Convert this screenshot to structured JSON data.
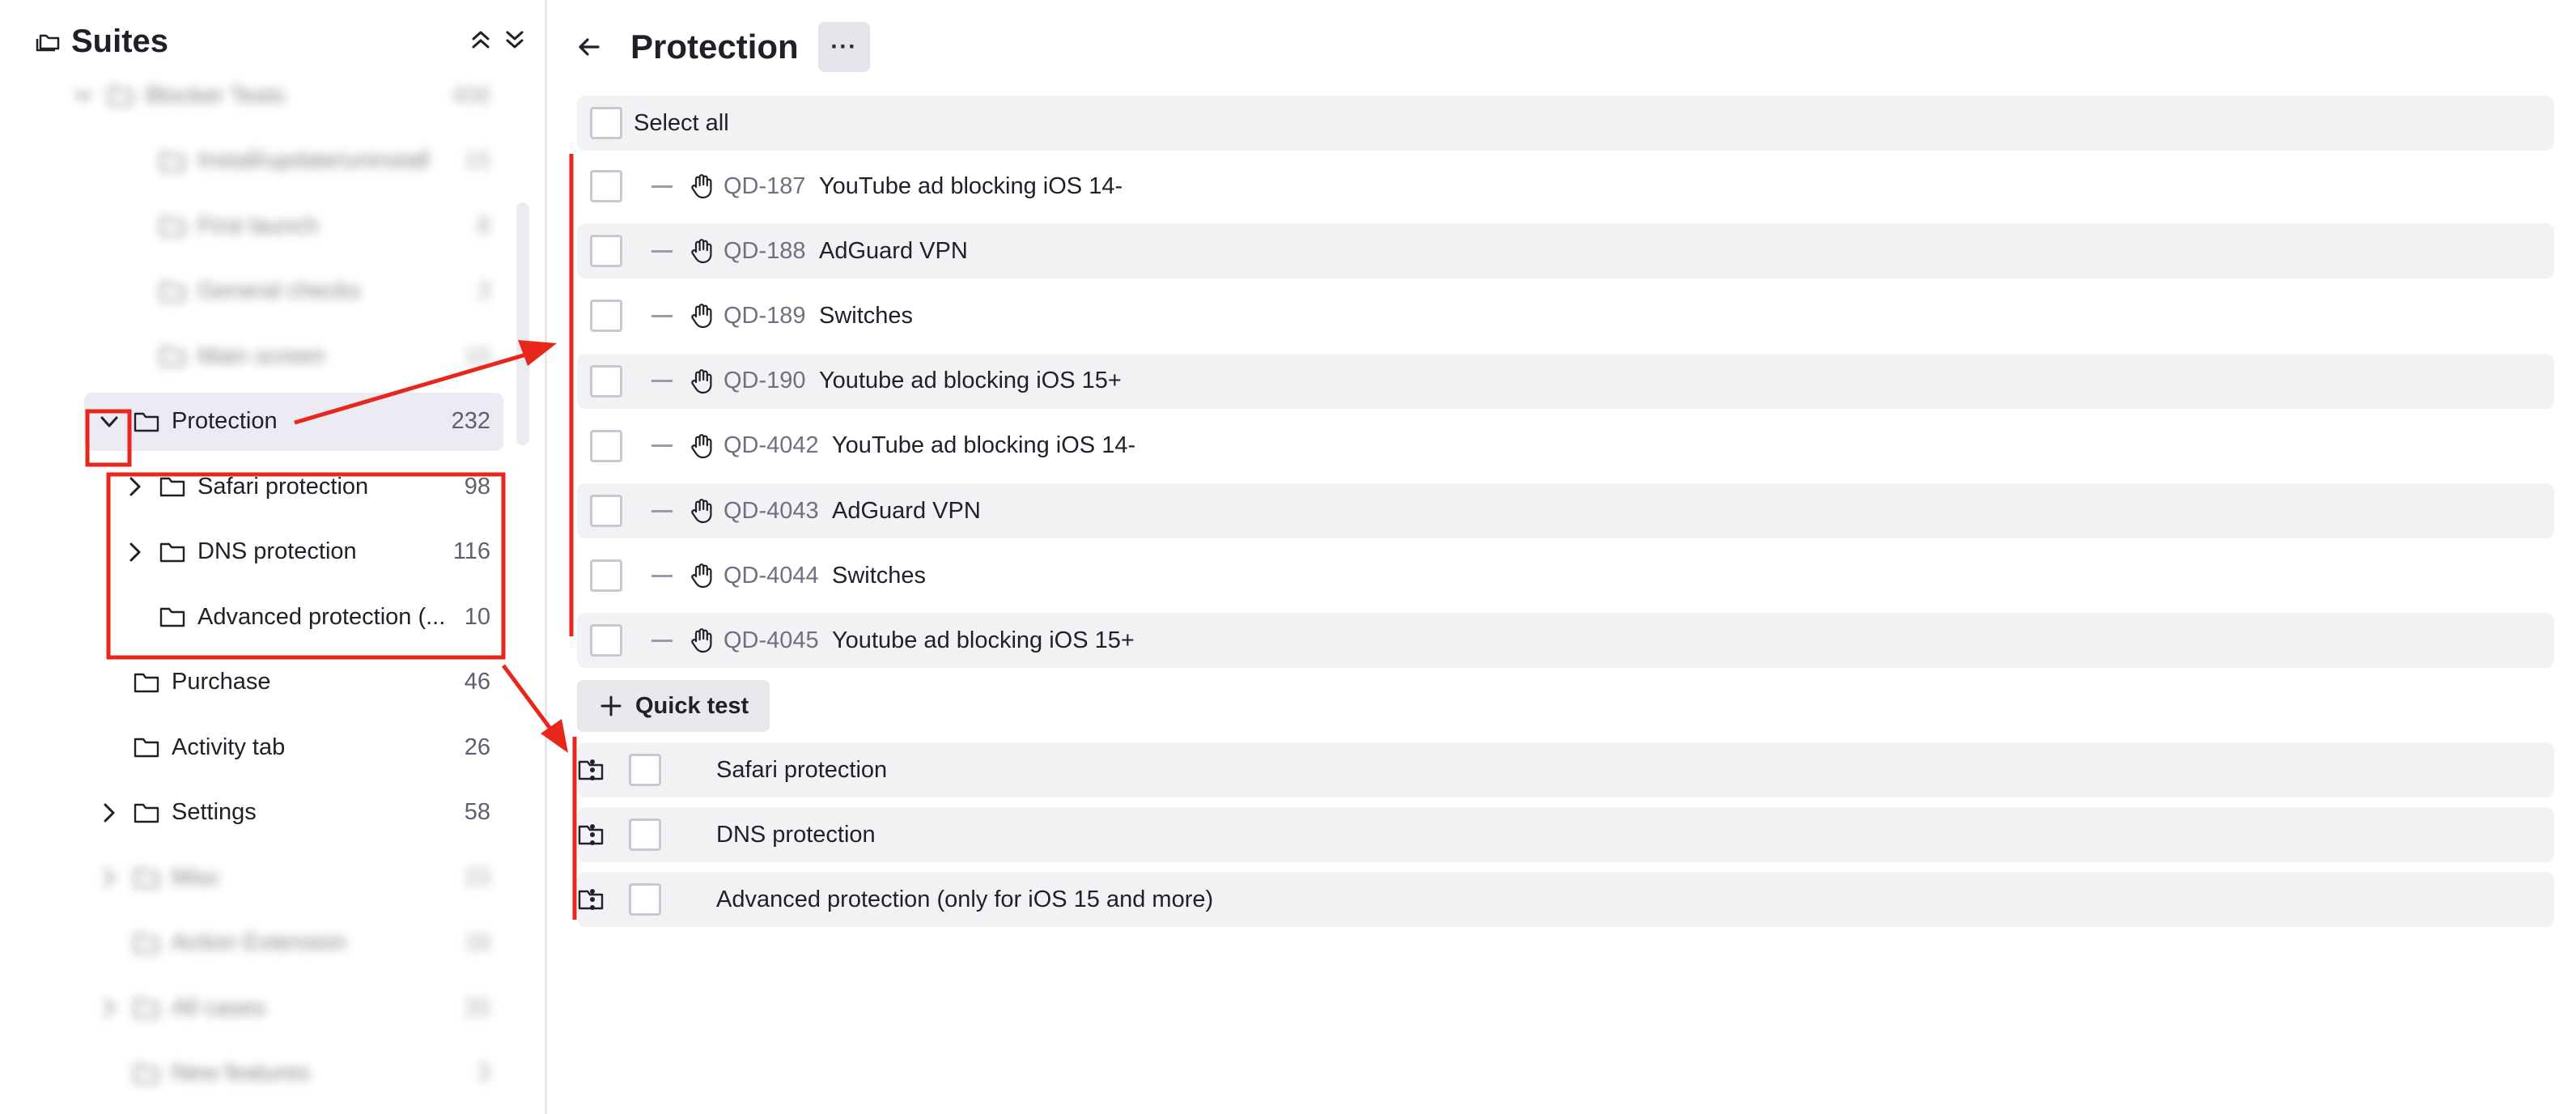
{
  "sidebar": {
    "title": "Suites",
    "items": [
      {
        "label": "Blocker Tests",
        "count": "406",
        "blurred": true
      },
      {
        "label": "Install/update/uninstall",
        "count": "15",
        "blurred": true
      },
      {
        "label": "First launch",
        "count": "8",
        "blurred": true
      },
      {
        "label": "General checks",
        "count": "3",
        "blurred": true
      },
      {
        "label": "Main screen",
        "count": "10",
        "blurred": true
      },
      {
        "label": "Protection",
        "count": "232",
        "expanded": true,
        "selected": true
      },
      {
        "label": "Safari protection",
        "count": "98"
      },
      {
        "label": "DNS protection",
        "count": "116"
      },
      {
        "label": "Advanced protection (...",
        "count": "10"
      },
      {
        "label": "Purchase",
        "count": "46"
      },
      {
        "label": "Activity tab",
        "count": "26"
      },
      {
        "label": "Settings",
        "count": "58"
      },
      {
        "label": "Misc",
        "count": "23",
        "blurred": true
      },
      {
        "label": "Action Extension",
        "count": "16",
        "blurred": true
      },
      {
        "label": "All cases",
        "count": "20",
        "blurred": true
      },
      {
        "label": "New features",
        "count": "3",
        "blurred": true
      }
    ]
  },
  "main": {
    "title": "Protection",
    "more_label": "···",
    "select_all_label": "Select all",
    "cases": [
      {
        "id": "QD-187",
        "title": "YouTube ad blocking iOS 14-"
      },
      {
        "id": "QD-188",
        "title": "AdGuard VPN"
      },
      {
        "id": "QD-189",
        "title": "Switches"
      },
      {
        "id": "QD-190",
        "title": "Youtube ad blocking iOS 15+"
      },
      {
        "id": "QD-4042",
        "title": "YouTube ad blocking iOS 14-"
      },
      {
        "id": "QD-4043",
        "title": "AdGuard VPN"
      },
      {
        "id": "QD-4044",
        "title": "Switches"
      },
      {
        "id": "QD-4045",
        "title": "Youtube ad blocking iOS 15+"
      }
    ],
    "quick_test_label": "Quick test",
    "suites": [
      {
        "label": "Safari protection"
      },
      {
        "label": "DNS protection"
      },
      {
        "label": "Advanced protection (only for iOS 15 and more)"
      }
    ]
  },
  "colors": {
    "annotation": "#e8261c",
    "selected_row": "#ecebf3",
    "row_shade": "#f2f2f5",
    "case_id": "#6f7183"
  },
  "icons": [
    "suites-icon",
    "collapse-all-icon",
    "expand-all-icon",
    "chevron-down-icon",
    "chevron-right-icon",
    "folder-icon",
    "back-arrow-icon",
    "hand-icon",
    "plus-icon",
    "drag-handle-icon"
  ]
}
